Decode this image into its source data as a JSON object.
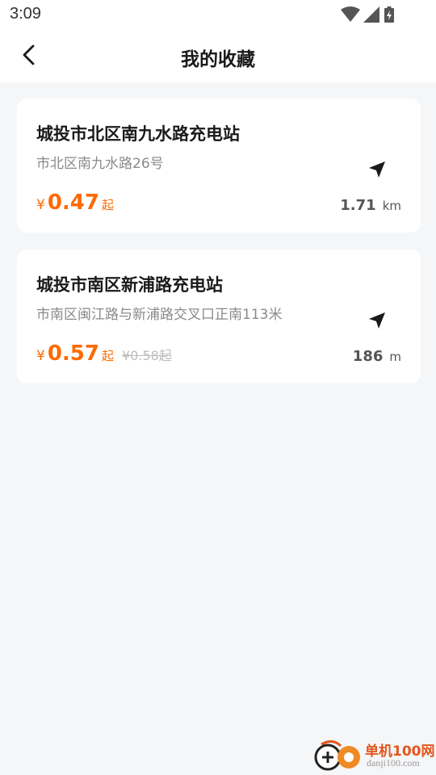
{
  "status_bar": {
    "time": "3:09",
    "icons": [
      "wifi-icon",
      "cellular-signal-icon",
      "battery-charging-icon"
    ]
  },
  "header": {
    "back_icon": "chevron-left-icon",
    "title": "我的收藏"
  },
  "favorites": [
    {
      "name": "城投市北区南九水路充电站",
      "address": "市北区南九水路26号",
      "currency": "¥",
      "price": "0.47",
      "price_suffix": "起",
      "original_price": "",
      "distance_value": "1.71",
      "distance_unit": "km",
      "nav_icon": "navigation-arrow-icon"
    },
    {
      "name": "城投市南区新浦路充电站",
      "address": "市南区闽江路与新浦路交叉口正南113米",
      "currency": "¥",
      "price": "0.57",
      "price_suffix": "起",
      "original_price": "¥0.58起",
      "distance_value": "186",
      "distance_unit": "m",
      "nav_icon": "navigation-arrow-icon"
    }
  ],
  "watermark": {
    "name": "单机100网",
    "domain": "danji100.com"
  },
  "colors": {
    "accent": "#ff6a00",
    "background": "#f5f6f8",
    "card": "#ffffff",
    "text_primary": "#1a1a1a",
    "text_secondary": "#8a8a8a"
  }
}
